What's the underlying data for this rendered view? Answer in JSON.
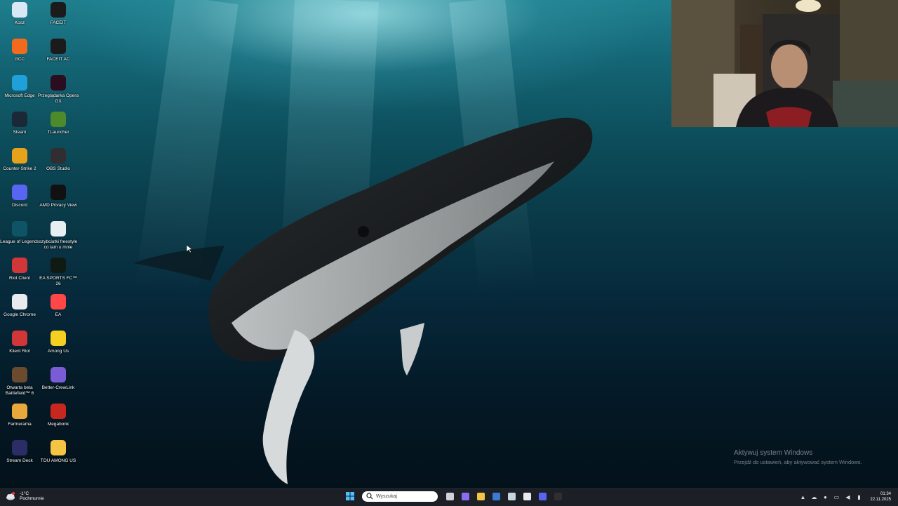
{
  "desktop_icons": [
    {
      "label": "Kosz",
      "icon": "recycle-bin-icon",
      "color": "#d9e8f5"
    },
    {
      "label": "FACEIT",
      "icon": "faceit-icon",
      "color": "#1b1b1b"
    },
    {
      "label": "GCC",
      "icon": "gcc-icon",
      "color": "#f26b1d"
    },
    {
      "label": "FACEIT AC",
      "icon": "faceit-ac-icon",
      "color": "#1b1b1b"
    },
    {
      "label": "Microsoft Edge",
      "icon": "edge-icon",
      "color": "#1fa0d8"
    },
    {
      "label": "Przeglądarka Opera GX",
      "icon": "opera-gx-icon",
      "color": "#2a0d1e"
    },
    {
      "label": "Steam",
      "icon": "steam-icon",
      "color": "#1b2838"
    },
    {
      "label": "TLauncher",
      "icon": "tlauncher-icon",
      "color": "#4c8a2a"
    },
    {
      "label": "Counter-Strike 2",
      "icon": "cs2-icon",
      "color": "#e7a21b"
    },
    {
      "label": "OBS Studio",
      "icon": "obs-icon",
      "color": "#302e31"
    },
    {
      "label": "Discord",
      "icon": "discord-icon",
      "color": "#5865f2"
    },
    {
      "label": "AMD Privacy View",
      "icon": "amd-privacy-icon",
      "color": "#111111"
    },
    {
      "label": "League of Legends",
      "icon": "lol-icon",
      "color": "#0f5466"
    },
    {
      "label": "szybciutki freestyle co tam u mnie",
      "icon": "document-icon",
      "color": "#e8eef2"
    },
    {
      "label": "Riot Client",
      "icon": "riot-icon",
      "color": "#d13639"
    },
    {
      "label": "EA SPORTS FC™ 26",
      "icon": "fc26-icon",
      "color": "#0e1a12"
    },
    {
      "label": "Google Chrome",
      "icon": "chrome-icon",
      "color": "#e8eaed"
    },
    {
      "label": "EA",
      "icon": "ea-icon",
      "color": "#ff4747"
    },
    {
      "label": "Klient Riot",
      "icon": "riot-icon",
      "color": "#d13639"
    },
    {
      "label": "Among Us",
      "icon": "among-us-icon",
      "color": "#f5d020"
    },
    {
      "label": "Otwarta beta Battlefield™ 6",
      "icon": "battlefield-icon",
      "color": "#6b4a2d"
    },
    {
      "label": "Better-CrewLink",
      "icon": "crewlink-icon",
      "color": "#7b5cd6"
    },
    {
      "label": "Farmerama",
      "icon": "farmerama-icon",
      "color": "#e9a93a"
    },
    {
      "label": "Megabonk",
      "icon": "megabonk-icon",
      "color": "#c8271f"
    },
    {
      "label": "Stream Deck",
      "icon": "stream-deck-icon",
      "color": "#2b2e66"
    },
    {
      "label": "TOU AMONG US",
      "icon": "folder-icon",
      "color": "#f4c542"
    }
  ],
  "watermark": {
    "title": "Aktywuj system Windows",
    "subtitle": "Przejdź do ustawień, aby aktywować system Windows."
  },
  "taskbar": {
    "weather_temp": "-1°C",
    "weather_desc": "Pochmurnie",
    "search_placeholder": "Wyszukaj",
    "apps": [
      {
        "name": "task-view-icon",
        "color": "#cfd3d8"
      },
      {
        "name": "copilot-icon",
        "color": "#8a6cf0"
      },
      {
        "name": "file-explorer-icon",
        "color": "#f4c542"
      },
      {
        "name": "microsoft-store-icon",
        "color": "#3a7bd5"
      },
      {
        "name": "steam-taskbar-icon",
        "color": "#c7d5e0"
      },
      {
        "name": "chrome-taskbar-icon",
        "color": "#e8eaed"
      },
      {
        "name": "discord-taskbar-icon",
        "color": "#5865f2"
      },
      {
        "name": "obs-taskbar-icon",
        "color": "#302e31"
      }
    ],
    "time": "01:34",
    "date": "22.11.2025"
  }
}
